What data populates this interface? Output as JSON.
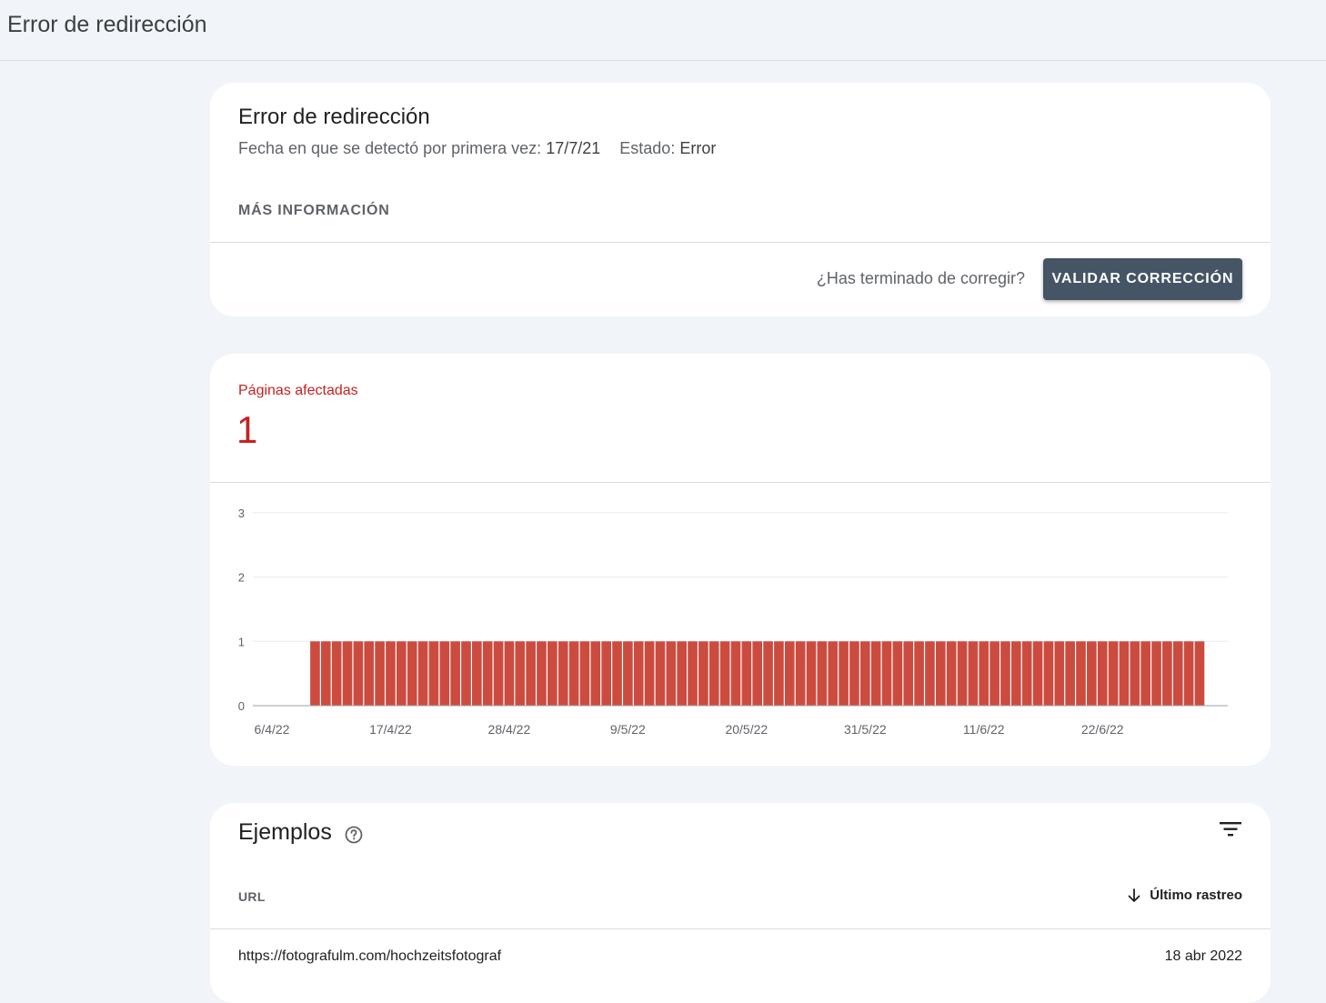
{
  "header": {
    "title": "Error de redirección"
  },
  "issue_card": {
    "title": "Error de redirección",
    "first_detected_label": "Fecha en que se detectó por primera vez:",
    "first_detected_value": "17/7/21",
    "status_label": "Estado:",
    "status_value": "Error",
    "more_info": "MÁS INFORMACIÓN",
    "fix_question": "¿Has terminado de corregir?",
    "validate_button": "VALIDAR CORRECCIÓN"
  },
  "summary": {
    "label": "Páginas afectadas",
    "value": "1",
    "accent_color": "#c5221f"
  },
  "chart_data": {
    "type": "bar",
    "x_start": "6/4/22",
    "x_end": "2/7/22",
    "x_tick_labels": [
      "6/4/22",
      "17/4/22",
      "28/4/22",
      "9/5/22",
      "20/5/22",
      "31/5/22",
      "11/6/22",
      "22/6/22"
    ],
    "first_bar_date": "10/4/22",
    "last_bar_date": "1/7/22",
    "bar_value": 1,
    "ylim": [
      0,
      3
    ],
    "y_ticks": [
      "0",
      "1",
      "2",
      "3"
    ],
    "bar_color": "#cc4b3f",
    "grid": true
  },
  "examples": {
    "title": "Ejemplos",
    "col_url": "URL",
    "col_last_crawl": "Último rastreo",
    "sort_icon": "arrow-down-icon",
    "rows": [
      {
        "url": "https://fotografulm.com/hochzeitsfotograf",
        "date": "18 abr 2022"
      }
    ]
  }
}
